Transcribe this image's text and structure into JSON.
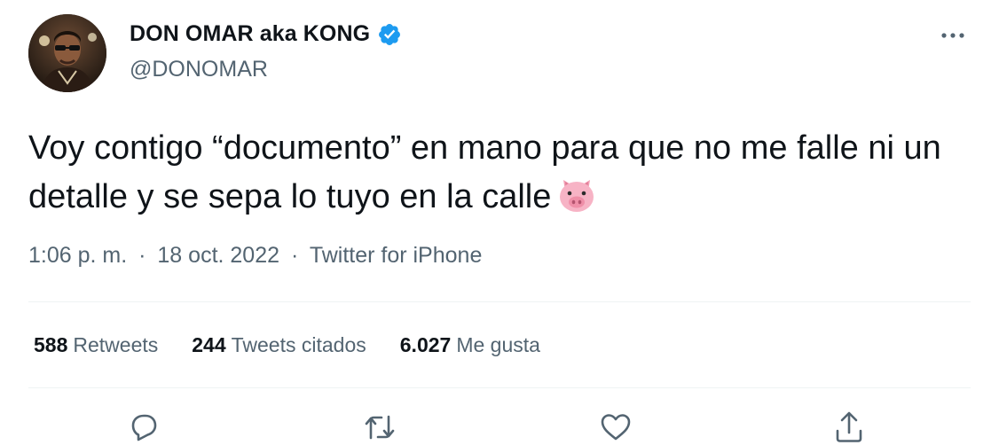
{
  "author": {
    "display_name": "DON OMAR aka KONG",
    "handle": "@DONOMAR",
    "verified": true
  },
  "tweet": {
    "text": "Voy contigo “documento” en mano para que no me falle ni un detalle y se sepa lo tuyo en la calle",
    "emoji": "pig-face"
  },
  "meta": {
    "time": "1:06 p. m.",
    "date": "18 oct. 2022",
    "separator": "·",
    "source": "Twitter for iPhone"
  },
  "stats": {
    "retweets": {
      "count": "588",
      "label": "Retweets"
    },
    "quotes": {
      "count": "244",
      "label": "Tweets citados"
    },
    "likes": {
      "count": "6.027",
      "label": "Me gusta"
    }
  },
  "colors": {
    "text": "#0f1419",
    "secondary": "#536471",
    "verified": "#1d9bf0",
    "divider": "#eff3f4"
  },
  "icons": [
    "more-icon",
    "verified-badge-icon",
    "pig-face-emoji",
    "reply-icon",
    "retweet-icon",
    "like-icon",
    "share-icon"
  ]
}
